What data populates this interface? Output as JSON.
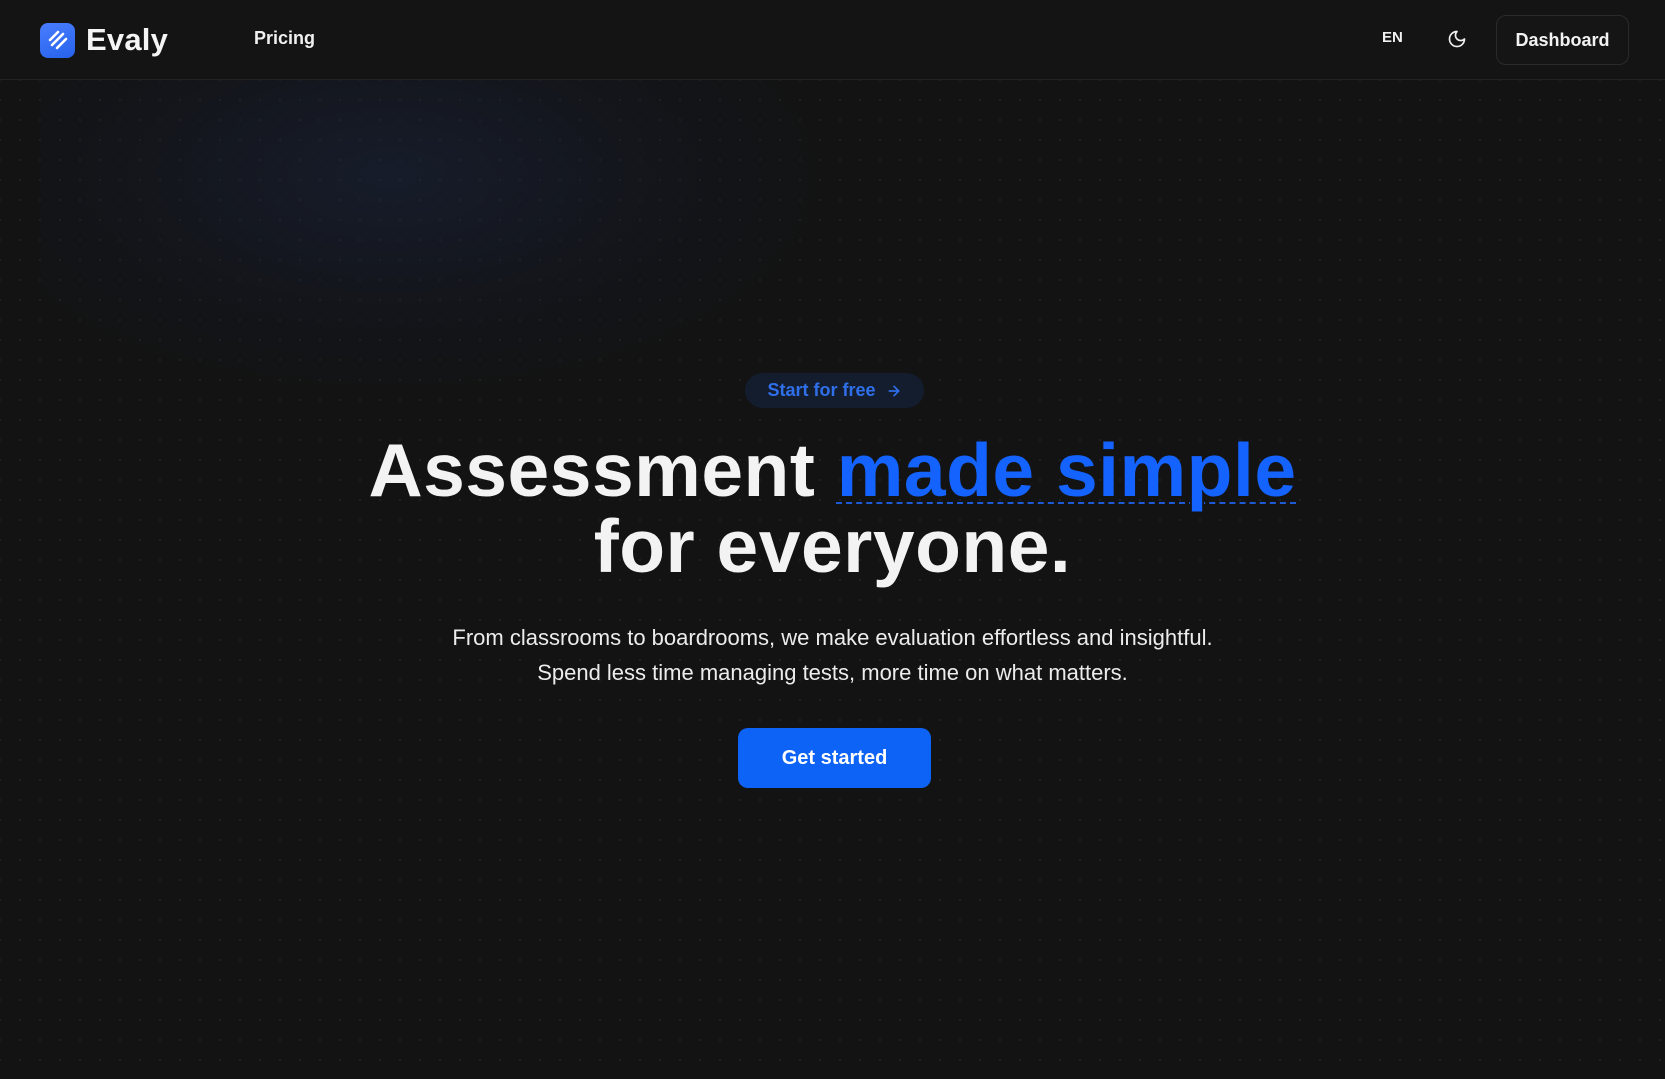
{
  "brand": {
    "name": "Evaly",
    "logo_icon": "evaly-logo-icon",
    "accent_color": "#1463ff"
  },
  "nav": {
    "items": [
      {
        "label": "Pricing"
      }
    ],
    "language": "EN",
    "theme_icon": "moon-icon",
    "dashboard_label": "Dashboard"
  },
  "hero": {
    "badge_label": "Start for free",
    "badge_icon": "arrow-right-icon",
    "headline_part1": "Assessment ",
    "headline_accent": "made simple",
    "headline_part2": "for everyone.",
    "subtext_line1": "From classrooms to boardrooms, we make evaluation effortless and insightful.",
    "subtext_line2": "Spend less time managing tests, more time on what matters.",
    "cta_label": "Get started"
  }
}
